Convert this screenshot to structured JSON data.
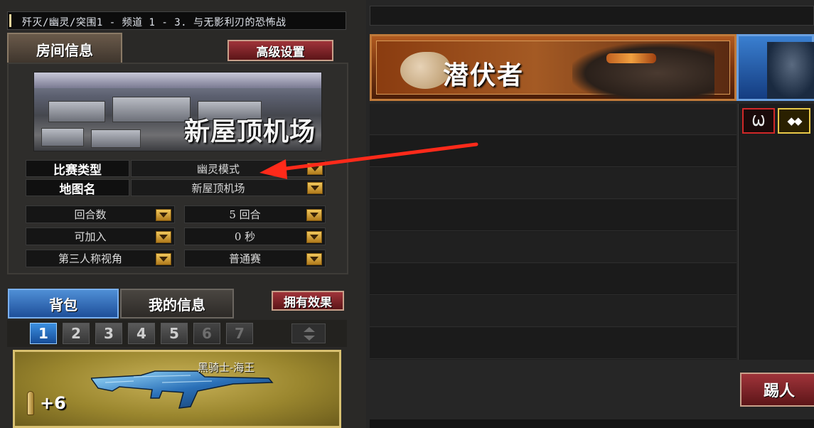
{
  "title_bar": {
    "text": "歼灭/幽灵/突围1 - 频道 1 - 3. 与无影利刃的恐怖战"
  },
  "room_tab": {
    "label": "房间信息"
  },
  "advanced_button": {
    "label": "高级设置"
  },
  "map_preview": {
    "map_name": "新屋顶机场"
  },
  "settings": {
    "match_type": {
      "label": "比赛类型",
      "value": "幽灵模式"
    },
    "map": {
      "label": "地图名",
      "value": "新屋顶机场"
    },
    "rounds_label": "回合数",
    "rounds_value": "5 回合",
    "joinable_label": "可加入",
    "joinable_value": "0 秒",
    "view_label": "第三人称视角",
    "match_mode": "普通赛"
  },
  "bag_tabs": {
    "bag": "背包",
    "my_info": "我的信息"
  },
  "effect_button": {
    "label": "拥有效果"
  },
  "bag_pages": [
    "1",
    "2",
    "3",
    "4",
    "5",
    "6",
    "7"
  ],
  "active_page": "1",
  "weapon": {
    "name": "黑骑士-海王",
    "ammo_bonus": "+6"
  },
  "team_banner": {
    "label": "潜伏者"
  },
  "badges": {
    "badge1": "Ѡ",
    "badge2": "◆◆"
  },
  "kick_button": {
    "label": "踢人"
  },
  "colors": {
    "accent_red": "#a0343a",
    "accent_blue": "#1e4f9a",
    "dropdown_gold": "#f2c85c",
    "annotation_arrow": "#ff2a1a"
  }
}
